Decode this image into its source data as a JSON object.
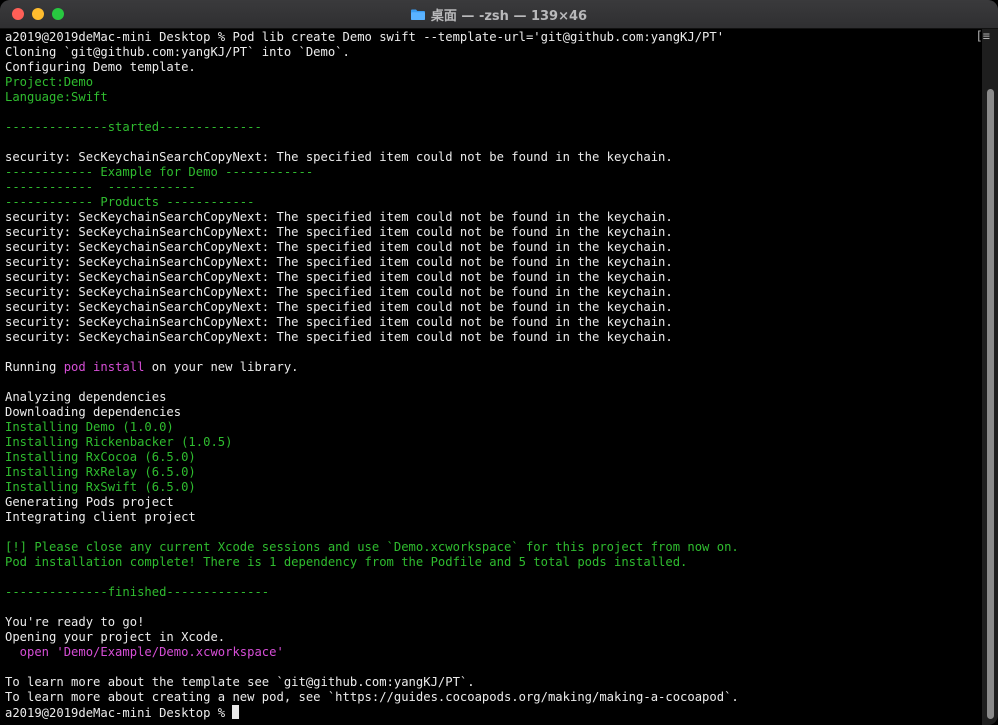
{
  "window": {
    "title": "桌面 — -zsh — 139×46"
  },
  "terminal": {
    "lines": [
      [
        {
          "t": "a2019@2019deMac-mini Desktop % Pod lib create Demo swift --template-url='git@github.com:yangKJ/PT'",
          "c": "white"
        }
      ],
      [
        {
          "t": "Cloning `git@github.com:yangKJ/PT` into `Demo`.",
          "c": "white"
        }
      ],
      [
        {
          "t": "Configuring Demo template.",
          "c": "white"
        }
      ],
      [
        {
          "t": "Project:Demo",
          "c": "green"
        }
      ],
      [
        {
          "t": "Language:Swift",
          "c": "green"
        }
      ],
      [],
      [
        {
          "t": "--------------started--------------",
          "c": "green"
        }
      ],
      [],
      [
        {
          "t": "security: SecKeychainSearchCopyNext: The specified item could not be found in the keychain.",
          "c": "white"
        }
      ],
      [
        {
          "t": "------------ Example for Demo ------------",
          "c": "green"
        }
      ],
      [
        {
          "t": "------------  ------------",
          "c": "green"
        }
      ],
      [
        {
          "t": "------------ Products ------------",
          "c": "green"
        }
      ],
      [
        {
          "t": "security: SecKeychainSearchCopyNext: The specified item could not be found in the keychain.",
          "c": "white"
        }
      ],
      [
        {
          "t": "security: SecKeychainSearchCopyNext: The specified item could not be found in the keychain.",
          "c": "white"
        }
      ],
      [
        {
          "t": "security: SecKeychainSearchCopyNext: The specified item could not be found in the keychain.",
          "c": "white"
        }
      ],
      [
        {
          "t": "security: SecKeychainSearchCopyNext: The specified item could not be found in the keychain.",
          "c": "white"
        }
      ],
      [
        {
          "t": "security: SecKeychainSearchCopyNext: The specified item could not be found in the keychain.",
          "c": "white"
        }
      ],
      [
        {
          "t": "security: SecKeychainSearchCopyNext: The specified item could not be found in the keychain.",
          "c": "white"
        }
      ],
      [
        {
          "t": "security: SecKeychainSearchCopyNext: The specified item could not be found in the keychain.",
          "c": "white"
        }
      ],
      [
        {
          "t": "security: SecKeychainSearchCopyNext: The specified item could not be found in the keychain.",
          "c": "white"
        }
      ],
      [
        {
          "t": "security: SecKeychainSearchCopyNext: The specified item could not be found in the keychain.",
          "c": "white"
        }
      ],
      [],
      [
        {
          "t": "Running ",
          "c": "white"
        },
        {
          "t": "pod install",
          "c": "magenta"
        },
        {
          "t": " on your new library.",
          "c": "white"
        }
      ],
      [],
      [
        {
          "t": "Analyzing dependencies",
          "c": "white"
        }
      ],
      [
        {
          "t": "Downloading dependencies",
          "c": "white"
        }
      ],
      [
        {
          "t": "Installing Demo (1.0.0)",
          "c": "green"
        }
      ],
      [
        {
          "t": "Installing Rickenbacker (1.0.5)",
          "c": "green"
        }
      ],
      [
        {
          "t": "Installing RxCocoa (6.5.0)",
          "c": "green"
        }
      ],
      [
        {
          "t": "Installing RxRelay (6.5.0)",
          "c": "green"
        }
      ],
      [
        {
          "t": "Installing RxSwift (6.5.0)",
          "c": "green"
        }
      ],
      [
        {
          "t": "Generating Pods project",
          "c": "white"
        }
      ],
      [
        {
          "t": "Integrating client project",
          "c": "white"
        }
      ],
      [],
      [
        {
          "t": "[!] Please close any current Xcode sessions and use `Demo.xcworkspace` for this project from now on.",
          "c": "green"
        }
      ],
      [
        {
          "t": "Pod installation complete! There is 1 dependency from the Podfile and 5 total pods installed.",
          "c": "green"
        }
      ],
      [],
      [
        {
          "t": "--------------finished--------------",
          "c": "green"
        }
      ],
      [],
      [
        {
          "t": "You're ready to go!",
          "c": "white"
        }
      ],
      [
        {
          "t": "Opening your project in Xcode.",
          "c": "white"
        }
      ],
      [
        {
          "t": "  open 'Demo/Example/Demo.xcworkspace'",
          "c": "magenta"
        }
      ],
      [],
      [
        {
          "t": "To learn more about the template see `git@github.com:yangKJ/PT`.",
          "c": "white"
        }
      ],
      [
        {
          "t": "To learn more about creating a new pod, see `https://guides.cocoapods.org/making/making-a-cocoapod`.",
          "c": "white"
        }
      ],
      [
        {
          "t": "a2019@2019deMac-mini Desktop % ",
          "c": "white"
        }
      ]
    ],
    "scroll_marker": "[≡"
  },
  "colors": {
    "green": "#2fbc2f",
    "magenta": "#d64ed6",
    "background": "#000000",
    "close": "#fe5f57",
    "minimize": "#febc2e",
    "maximize": "#28c840"
  },
  "icons": {
    "title_icon": "folder-icon"
  }
}
